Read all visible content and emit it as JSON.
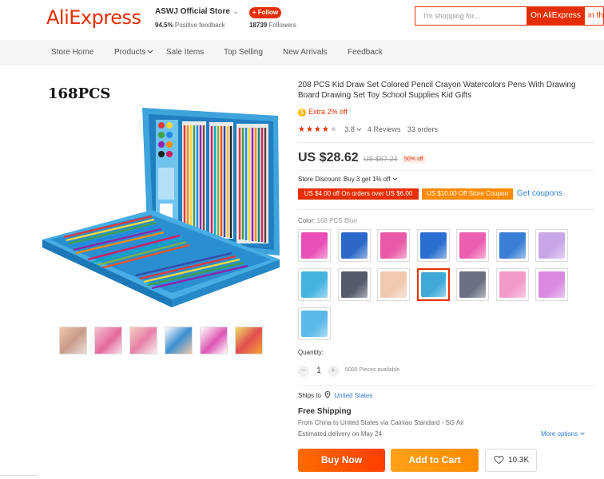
{
  "header": {
    "logo": "AliExpress",
    "store_name": "ASWJ Official Store",
    "store_chevron": "⌄",
    "feedback_pct": "94.5%",
    "feedback_label": "Positive feedback",
    "follow_label": "+ Follow",
    "followers_count": "18739",
    "followers_label": "Followers",
    "search_placeholder": "I'm shopping for...",
    "search_btn": "On AliExpress",
    "search_btn_2": "in th"
  },
  "nav": {
    "items": [
      "Store Home",
      "Products",
      "Sale Items",
      "Top Selling",
      "New Arrivals",
      "Feedback"
    ]
  },
  "product": {
    "image_caption": "168PCS",
    "title": "208 PCS Kid Draw Set Colored Pencil Crayon Watercolors Pens With Drawing Board Drawing Set Toy School Supplies Kid Gifts",
    "extra_off": "Extra 2% off",
    "rating_value": "3.8",
    "rating_stars": 3.8,
    "reviews": "4 Reviews",
    "orders": "33 orders",
    "price": "US $28.62",
    "original_price": "US $57.24",
    "discount_badge": "50% off",
    "store_discount": "Store Discount: Buy 3 get 1% off",
    "coupon_1": "US $4.00 off On orders over US $6.00",
    "coupon_2": "US $10.00 Off Store Coupon",
    "get_coupons": "Get coupons",
    "color_label": "Color:",
    "color_value": "168 PCS Blue",
    "swatch_colors": [
      "#e94fb6",
      "#2b68c8",
      "#e85aa8",
      "#2a6fcf",
      "#ec5fb0",
      "#3a7fd5",
      "#c8a6e8",
      "#45b3e0",
      "#555b6a",
      "#f0c9b0",
      "#3fa9d8",
      "#6a6f82",
      "#f39ac8",
      "#d88ae0",
      "#5bb8e8"
    ],
    "selected_swatch": 10,
    "quantity_label": "Quantity:",
    "quantity_value": "1",
    "qty_minus": "−",
    "qty_plus": "+",
    "available": "5000 Pieces available",
    "ships_to_label": "Ships to",
    "ships_to": "United States",
    "free_shipping": "Free Shipping",
    "shipping_via": "From China to United States via Cainiao Standard - SG Air",
    "estimated": "Estimated delivery on May 24",
    "more_options": "More options",
    "buy_now": "Buy Now",
    "add_to_cart": "Add to Cart",
    "wishlist_count": "10.3K"
  },
  "colors": {
    "brand": "#e62e04",
    "orange": "#ff8a00",
    "link": "#2e7dd7"
  }
}
